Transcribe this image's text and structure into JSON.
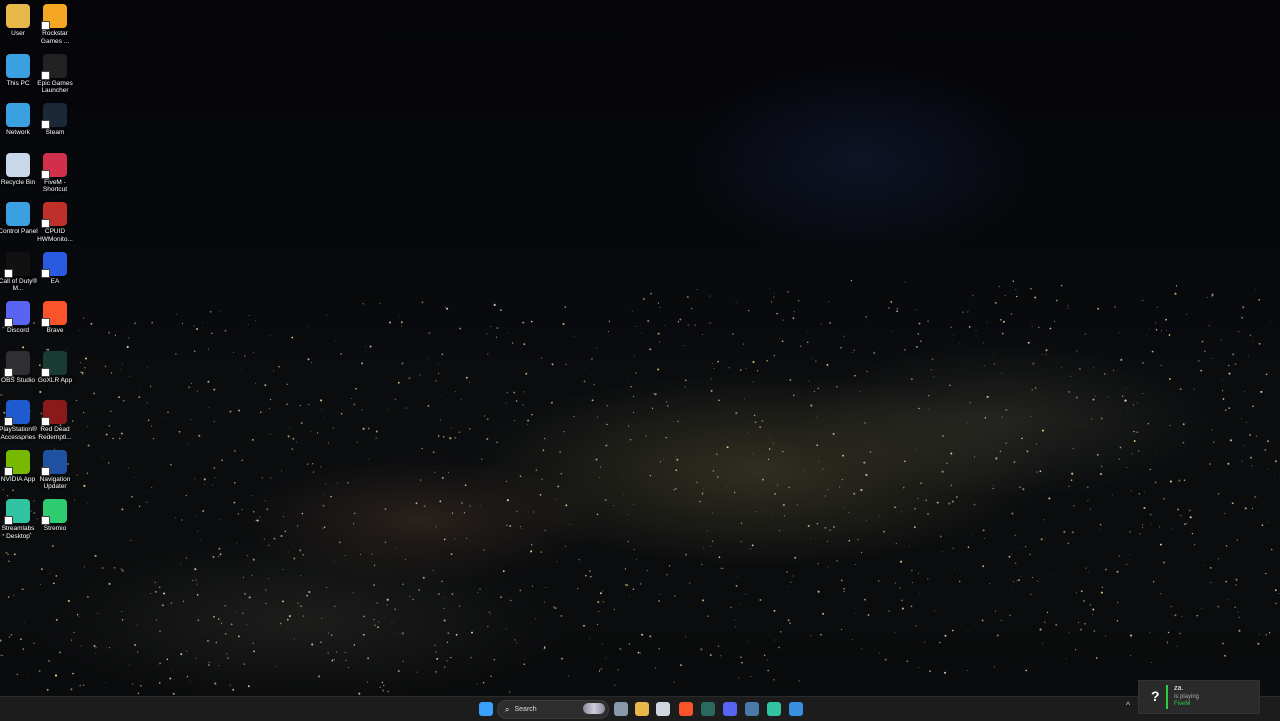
{
  "desktop": {
    "icons": [
      {
        "id": "user",
        "label": "User",
        "icon": "folder-icon",
        "color": "#e8b84a"
      },
      {
        "id": "rockstar",
        "label": "Rockstar Games ...",
        "icon": "rockstar-icon",
        "color": "#f5a623"
      },
      {
        "id": "this-pc",
        "label": "This PC",
        "icon": "monitor-icon",
        "color": "#3aa0e0"
      },
      {
        "id": "epic",
        "label": "Epic Games Launcher",
        "icon": "epic-games-icon",
        "color": "#222222"
      },
      {
        "id": "network",
        "label": "Network",
        "icon": "network-icon",
        "color": "#3aa0e0"
      },
      {
        "id": "steam",
        "label": "Steam",
        "icon": "steam-icon",
        "color": "#1b2838"
      },
      {
        "id": "recycle",
        "label": "Recycle Bin",
        "icon": "recycle-bin-icon",
        "color": "#c8d8e8"
      },
      {
        "id": "fivem",
        "label": "FiveM - Shortcut",
        "icon": "fivem-icon",
        "color": "#d0304a"
      },
      {
        "id": "control",
        "label": "Control Panel",
        "icon": "control-panel-icon",
        "color": "#3aa0e0"
      },
      {
        "id": "cpuid",
        "label": "CPUID HWMonito...",
        "icon": "cpuid-icon",
        "color": "#c0302a"
      },
      {
        "id": "cod",
        "label": "Call of Duty® M...",
        "icon": "mw-icon",
        "color": "#111111"
      },
      {
        "id": "ea",
        "label": "EA",
        "icon": "ea-icon",
        "color": "#2a5ae0"
      },
      {
        "id": "discord",
        "label": "Discord",
        "icon": "discord-icon",
        "color": "#5865f2"
      },
      {
        "id": "brave",
        "label": "Brave",
        "icon": "brave-icon",
        "color": "#fb542b"
      },
      {
        "id": "obs",
        "label": "OBS Studio",
        "icon": "obs-icon",
        "color": "#302e31"
      },
      {
        "id": "goxlr",
        "label": "GoXLR App",
        "icon": "goxlr-icon",
        "color": "#1a3a34"
      },
      {
        "id": "ps",
        "label": "PlayStation® Accessories",
        "icon": "playstation-icon",
        "color": "#1f5ad0"
      },
      {
        "id": "rdr",
        "label": "Red Dead Redempti...",
        "icon": "red-dead-icon",
        "color": "#8a1a1a"
      },
      {
        "id": "nvidia",
        "label": "NVIDIA App",
        "icon": "nvidia-icon",
        "color": "#76b900"
      },
      {
        "id": "nav",
        "label": "Navigation Updater",
        "icon": "navigation-updater-icon",
        "color": "#2050a0"
      },
      {
        "id": "streamlabs",
        "label": "Streamlabs Desktop",
        "icon": "streamlabs-icon",
        "color": "#31c3a2"
      },
      {
        "id": "stremio",
        "label": "Stremio",
        "icon": "stremio-icon",
        "color": "#2ecc71"
      }
    ]
  },
  "taskbar": {
    "search_label": "Search",
    "apps": [
      {
        "name": "start-button",
        "color": "#3aa0ff"
      },
      {
        "name": "taskview-button",
        "color": "#8899aa"
      },
      {
        "name": "file-explorer-button",
        "color": "#e8b84a"
      },
      {
        "name": "microsoft-store-button",
        "color": "#cfd8e0"
      },
      {
        "name": "brave-taskbar-button",
        "color": "#fb542b"
      },
      {
        "name": "goxlr-taskbar-button",
        "color": "#2a6a60"
      },
      {
        "name": "discord-taskbar-button",
        "color": "#5865f2"
      },
      {
        "name": "steam-taskbar-button",
        "color": "#4a7aa8"
      },
      {
        "name": "streamlabs-taskbar-button",
        "color": "#31c3a2"
      },
      {
        "name": "photos-taskbar-button",
        "color": "#3a90e0"
      }
    ]
  },
  "game_toast": {
    "user": "za.",
    "status": "is playing",
    "game": "FiveM"
  }
}
